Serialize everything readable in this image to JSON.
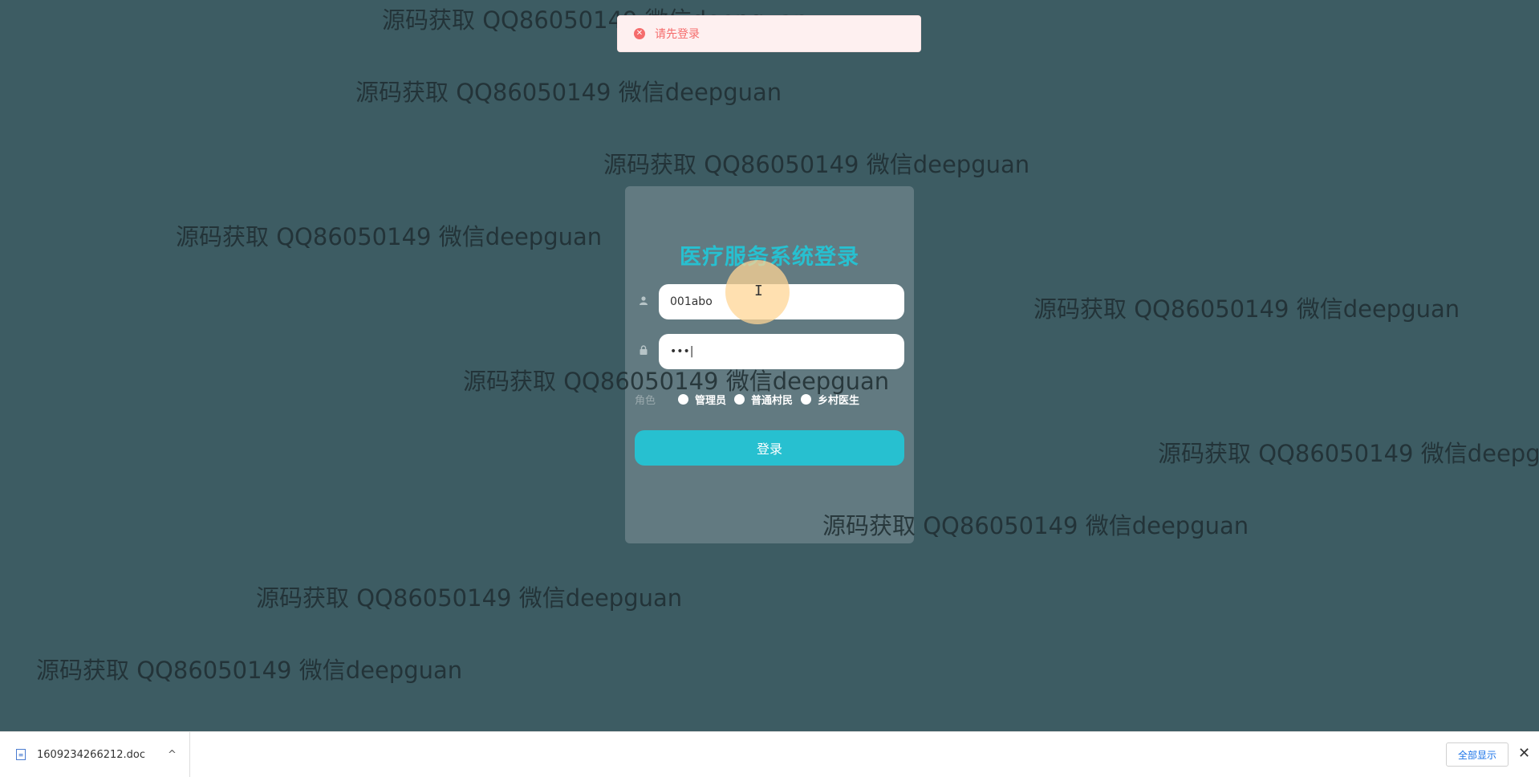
{
  "watermark_text": "源码获取 QQ86050149 微信deepguan",
  "toast": {
    "message": "请先登录",
    "icon": "error-circle-icon",
    "color": "#f56c6c"
  },
  "login": {
    "title": "医疗服务系统登录",
    "username_value": "001abo",
    "password_value": "•••|",
    "role_label": "角色",
    "roles": [
      "管理员",
      "普通村民",
      "乡村医生"
    ],
    "submit_label": "登录",
    "accent_color": "#27c0d0"
  },
  "download_bar": {
    "file_name": "1609234266212.doc",
    "show_all_label": "全部显示",
    "close_glyph": "✕",
    "chevron_glyph": "^"
  }
}
